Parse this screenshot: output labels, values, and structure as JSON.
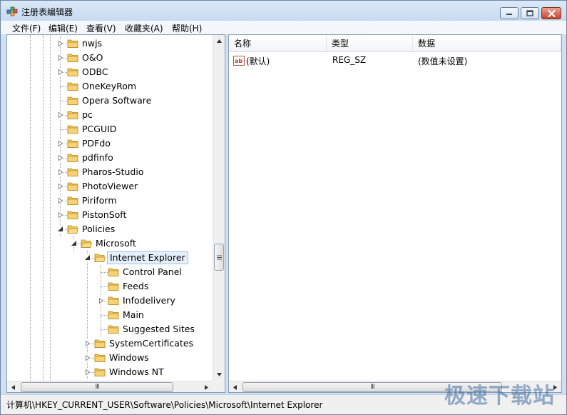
{
  "window": {
    "title": "注册表编辑器"
  },
  "menu": [
    "文件(F)",
    "编辑(E)",
    "查看(V)",
    "收藏夹(A)",
    "帮助(H)"
  ],
  "tree": {
    "nodes": [
      {
        "label": "nwjs",
        "expandable": true,
        "selected": false
      },
      {
        "label": "O&O",
        "expandable": true,
        "selected": false
      },
      {
        "label": "ODBC",
        "expandable": true,
        "selected": false
      },
      {
        "label": "OneKeyRom",
        "expandable": false,
        "selected": false
      },
      {
        "label": "Opera Software",
        "expandable": false,
        "selected": false
      },
      {
        "label": "pc",
        "expandable": true,
        "selected": false
      },
      {
        "label": "PCGUID",
        "expandable": false,
        "selected": false
      },
      {
        "label": "PDFdo",
        "expandable": true,
        "selected": false
      },
      {
        "label": "pdfinfo",
        "expandable": true,
        "selected": false
      },
      {
        "label": "Pharos-Studio",
        "expandable": true,
        "selected": false
      },
      {
        "label": "PhotoViewer",
        "expandable": true,
        "selected": false
      },
      {
        "label": "Piriform",
        "expandable": true,
        "selected": false
      },
      {
        "label": "PistonSoft",
        "expandable": true,
        "selected": false
      },
      {
        "label": "Policies",
        "expandable": true,
        "expanded": true,
        "selected": false
      },
      {
        "label": "Microsoft",
        "expandable": true,
        "expanded": true,
        "selected": false
      },
      {
        "label": "Internet Explorer",
        "expandable": true,
        "expanded": true,
        "selected": true
      },
      {
        "label": "Control Panel",
        "expandable": false,
        "selected": false
      },
      {
        "label": "Feeds",
        "expandable": false,
        "selected": false
      },
      {
        "label": "Infodelivery",
        "expandable": true,
        "selected": false
      },
      {
        "label": "Main",
        "expandable": false,
        "selected": false
      },
      {
        "label": "Suggested Sites",
        "expandable": false,
        "selected": false
      },
      {
        "label": "SystemCertificates",
        "expandable": true,
        "selected": false
      },
      {
        "label": "Windows",
        "expandable": true,
        "selected": false
      },
      {
        "label": "Windows NT",
        "expandable": true,
        "selected": false
      }
    ]
  },
  "list": {
    "columns": {
      "name": "名称",
      "type": "类型",
      "data": "数据"
    },
    "rows": [
      {
        "name": "(默认)",
        "type": "REG_SZ",
        "data": "(数值未设置)",
        "icon": "string-value-icon"
      }
    ]
  },
  "status": {
    "path": "计算机\\HKEY_CURRENT_USER\\Software\\Policies\\Microsoft\\Internet Explorer"
  },
  "watermark": "极速下载站",
  "scroll_glyph": "III",
  "colors": {
    "folder": "#f2c45a",
    "selection_bg": "#e6f0fb",
    "selection_border": "#9cc1ea",
    "close_button": "#c7432a"
  }
}
